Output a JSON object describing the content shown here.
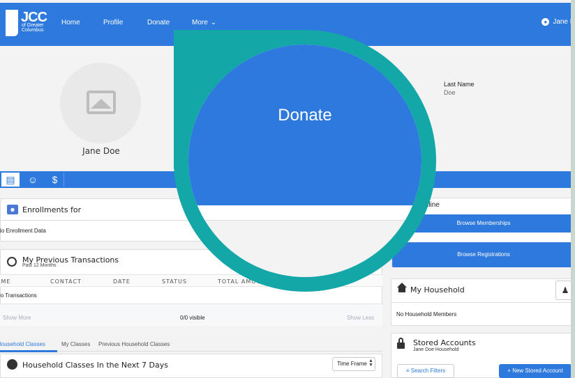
{
  "nav": {
    "logo_text": "JCC",
    "logo_sub": [
      "of Greater",
      "Columbus"
    ],
    "links": [
      "Home",
      "Profile",
      "Donate",
      "More"
    ],
    "more_chevron": "chevron-down-icon",
    "user_name": "Jane D"
  },
  "profile": {
    "full_name": "Jane Doe",
    "last_name_label": "Last Name",
    "last_name_value": "Doe"
  },
  "tabs": [
    "id-card-icon",
    "people-icon",
    "money-bag-icon"
  ],
  "enrollments": {
    "title": "Enrollments for",
    "empty": "No Enrollment Data"
  },
  "transactions": {
    "title": "My Previous Transactions",
    "subtitle": "Past 12 Months",
    "columns": [
      "NAME",
      "CONTACT",
      "DATE",
      "STATUS",
      "TOTAL AMOUNT"
    ],
    "empty": "No Transactions",
    "show_more": "Show More",
    "visible": "0/0 visible",
    "show_less": "Show Less"
  },
  "classes": {
    "tabs": [
      "Household Classes",
      "My Classes",
      "Previous Household Classes"
    ],
    "title": "Household Classes In the Next 7 Days",
    "time_frame": "Time Frame"
  },
  "online": {
    "title": "Online",
    "browse_memberships": "Browse Memberships",
    "browse_registrations": "Browse Registrations"
  },
  "household": {
    "title": "My Household",
    "empty": "No Household Members"
  },
  "stored": {
    "title": "Stored Accounts",
    "subtitle": "Jane Doe Household",
    "search_filters": "Search Filters",
    "new_account": "New Stored Account"
  },
  "overlay": {
    "label": "Donate"
  },
  "colors": {
    "brand_blue": "#2e79dd",
    "overlay_teal": "#14a7a7"
  }
}
